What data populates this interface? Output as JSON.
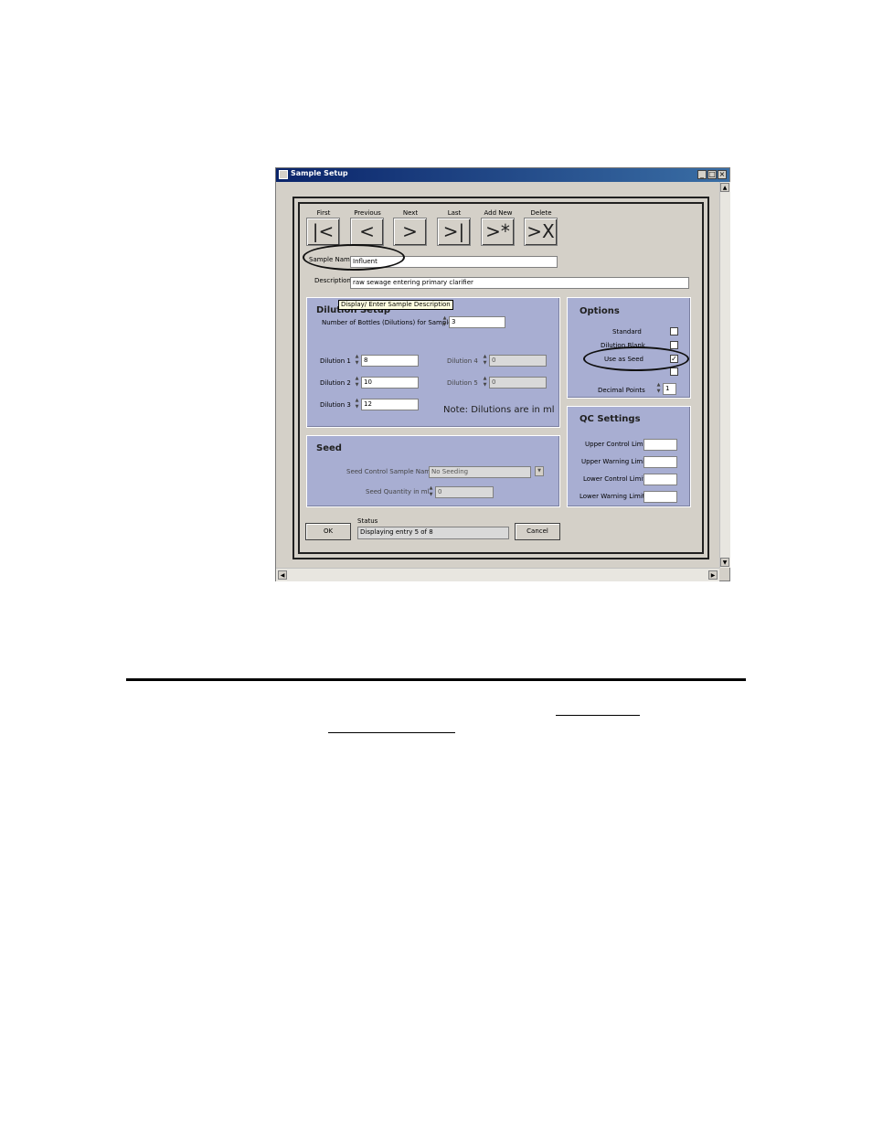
{
  "window": {
    "title": "Sample Setup",
    "minimize": "_",
    "maximize": "□",
    "close": "×"
  },
  "nav": [
    {
      "label": "First",
      "glyph": "|<"
    },
    {
      "label": "Previous",
      "glyph": "<"
    },
    {
      "label": "Next",
      "glyph": ">"
    },
    {
      "label": "Last",
      "glyph": ">|"
    },
    {
      "label": "Add New",
      "glyph": ">*"
    },
    {
      "label": "Delete",
      "glyph": ">X"
    }
  ],
  "sample": {
    "name_label": "Sample Name",
    "name_value": "Influent",
    "description_label": "Description",
    "description_value": "raw sewage entering primary clarifier",
    "tooltip": "Display/ Enter Sample Description"
  },
  "dilution": {
    "title": "Dilution Setup",
    "bottles_label": "Number of Bottles (Dilutions) for Sample",
    "bottles_value": "3",
    "d1_label": "Dilution 1",
    "d1_value": "8",
    "d2_label": "Dilution 2",
    "d2_value": "10",
    "d3_label": "Dilution 3",
    "d3_value": "12",
    "d4_label": "Dilution 4",
    "d4_value": "0",
    "d5_label": "Dilution 5",
    "d5_value": "0",
    "note": "Note: Dilutions are in ml"
  },
  "options": {
    "title": "Options",
    "standard_label": "Standard",
    "dilution_blank_label": "Dilution Blank",
    "use_as_seed_label": "Use as Seed",
    "use_as_seed_mark": "✓",
    "decimal_points_label": "Decimal Points",
    "decimal_points_value": "1"
  },
  "qc": {
    "title": "QC Settings",
    "ucl_label": "Upper Control Limit",
    "uwl_label": "Upper Warning Limit",
    "lcl_label": "Lower Control Limit",
    "lwl_label": "Lower Warning Limit"
  },
  "seed": {
    "title": "Seed",
    "control_label": "Seed Control Sample Name",
    "control_value": "No Seeding",
    "quantity_label": "Seed Quantity in ml",
    "quantity_value": "0"
  },
  "footer": {
    "ok_label": "OK",
    "status_label": "Status",
    "status_value": "Displaying entry 5 of 8",
    "cancel_label": "Cancel"
  },
  "colors": {
    "group_bg": "#a8aed2",
    "title_bar": "#0a246a"
  }
}
